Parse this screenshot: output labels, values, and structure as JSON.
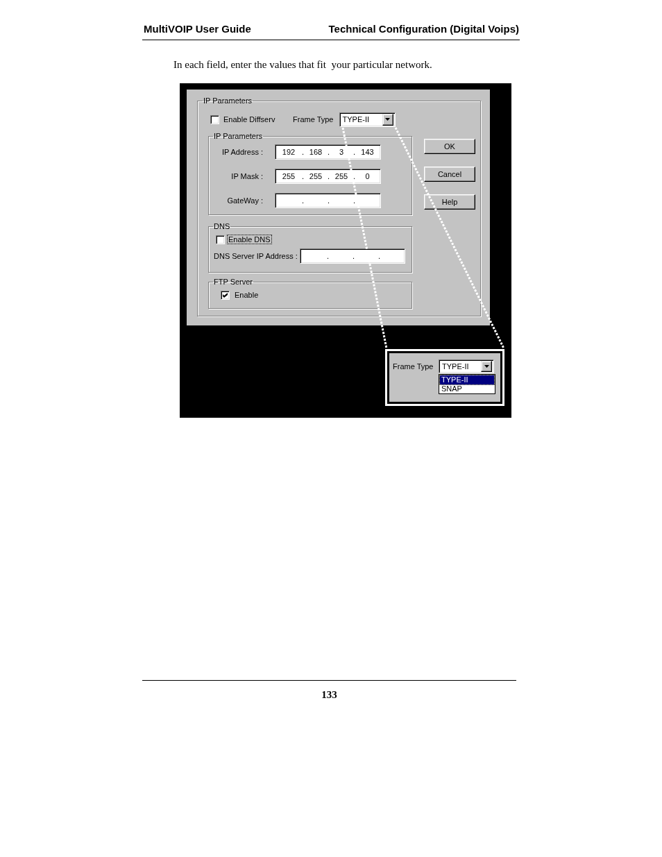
{
  "header": {
    "title": "MultiVOIP User Guide",
    "section": "Technical Configuration (Digital Voips)"
  },
  "intro": "In each field, enter the values that fit  your particular network.",
  "dialog": {
    "group": {
      "title": "IP Parameters",
      "diffserv": {
        "label": "Enable Diffserv",
        "checked": false
      },
      "frame_type": {
        "label": "Frame Type",
        "value": "TYPE-II"
      },
      "ip_group": {
        "title": "IP Parameters",
        "fields": [
          {
            "label": "IP Address :",
            "octets": [
              "192",
              "168",
              "3",
              "143"
            ],
            "separators": [
              ".",
              ".",
              "."
            ]
          },
          {
            "label": "IP Mask :",
            "octets": [
              "255",
              "255",
              "255",
              "0"
            ],
            "separators": [
              ".",
              ".",
              "."
            ]
          },
          {
            "label": "GateWay :",
            "separators": [
              ".",
              ".",
              "."
            ]
          }
        ]
      },
      "dns_group": {
        "title": "DNS",
        "enable": {
          "label": "Enable DNS",
          "checked": false,
          "focused": true
        },
        "server": {
          "label": "DNS Server IP Address :",
          "separators": [
            ".",
            ".",
            "."
          ]
        }
      },
      "ftp_group": {
        "title": "FTP Server",
        "enable": {
          "label": "Enable",
          "checked": true
        }
      }
    },
    "buttons": [
      {
        "label": "OK"
      },
      {
        "label": "Cancel"
      },
      {
        "label": "Help"
      }
    ]
  },
  "inset": {
    "label": "Frame Type",
    "value": "TYPE-II",
    "expanded": true,
    "options": [
      {
        "label": "TYPE-II",
        "selected": true
      },
      {
        "label": "SNAP",
        "selected": false
      }
    ]
  },
  "footer": {
    "page_number": "133"
  }
}
